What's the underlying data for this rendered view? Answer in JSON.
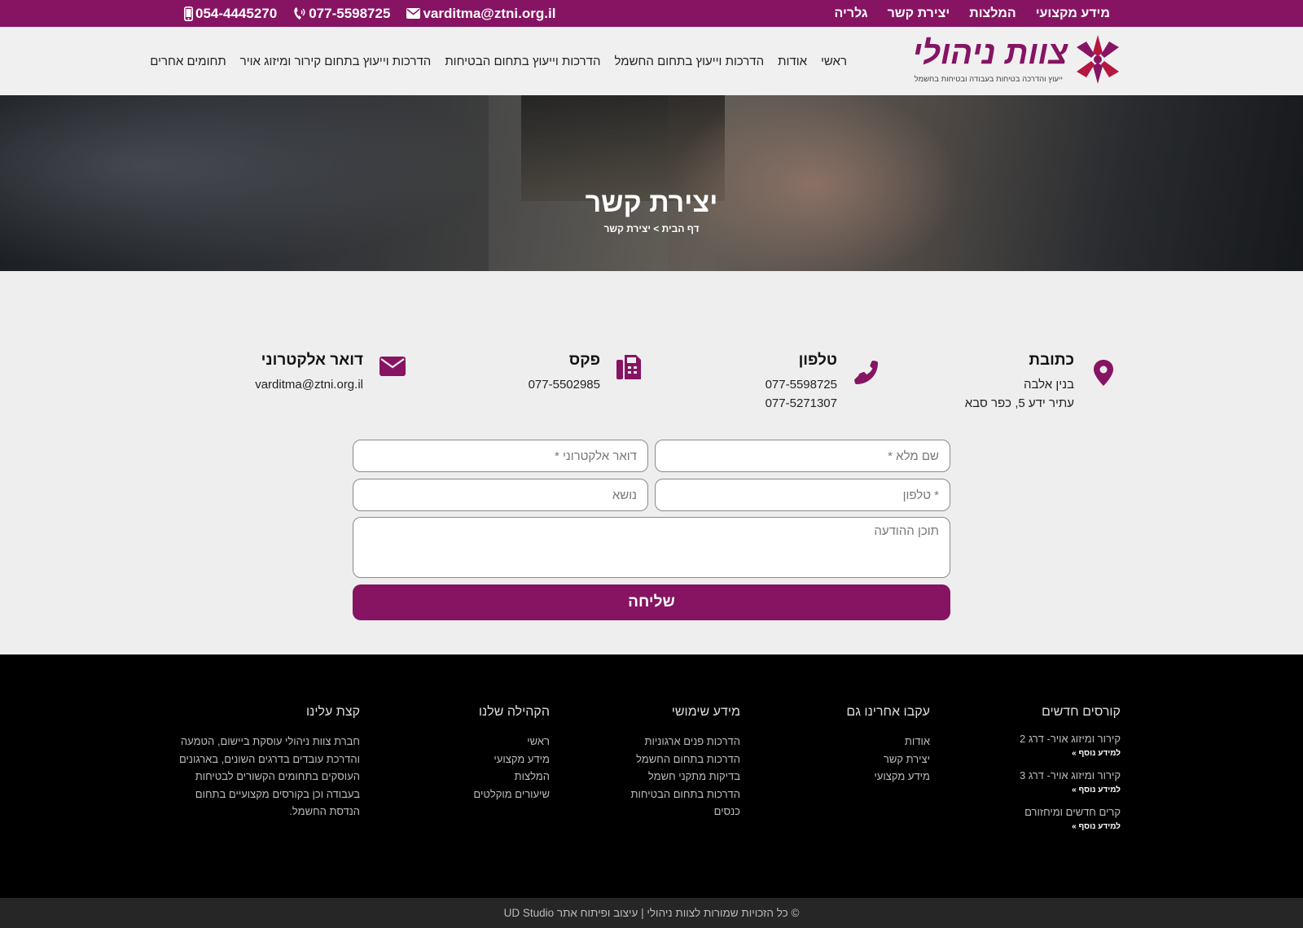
{
  "topbar": {
    "nav": [
      "מידע מקצועי",
      "המלצות",
      "יצירת קשר",
      "גלריה"
    ],
    "email": "varditma@ztni.org.il",
    "phone": "077-5598725",
    "mobile": "054-4445270"
  },
  "header": {
    "logo_title": "צוות ניהולי",
    "logo_tagline": "ייעוץ והדרכה בטיחות בעבודה ובטיחות בחשמל",
    "nav": [
      "ראשי",
      "אודות",
      "הדרכות וייעוץ בתחום החשמל",
      "הדרכות וייעוץ בתחום הבטיחות",
      "הדרכות וייעוץ בתחום קירור ומיזוג אויר",
      "תחומים אחרים"
    ]
  },
  "hero": {
    "title": "יצירת קשר",
    "breadcrumb": "דף הבית > יצירת קשר"
  },
  "info": {
    "address": {
      "title": "כתובת",
      "lines": [
        "בנין אלבה",
        "עתיר ידע 5, כפר סבא"
      ]
    },
    "phone": {
      "title": "טלפון",
      "lines": [
        "077-5598725",
        "077-5271307"
      ]
    },
    "fax": {
      "title": "פקס",
      "lines": [
        "077-5502985"
      ]
    },
    "email": {
      "title": "דואר אלקטרוני",
      "lines": [
        "varditma@ztni.org.il"
      ]
    }
  },
  "form": {
    "name_placeholder": "שם מלא *",
    "email_placeholder": "דואר אלקטרוני *",
    "phone_placeholder": "* טלפון",
    "subject_placeholder": "נושא",
    "message_placeholder": "תוכן ההודעה",
    "submit_label": "שליחה"
  },
  "footer": {
    "courses": {
      "title": "קורסים חדשים",
      "items": [
        {
          "name": "קירור ומיזוג אויר- דרג 2",
          "more": "למידע נוסף »"
        },
        {
          "name": "קירור ומיזוג אויר- דרג 3",
          "more": "למידע נוסף »"
        },
        {
          "name": "קרים חדשים ומיחזורם",
          "more": "למידע נוסף »"
        }
      ]
    },
    "follow": {
      "title": "עקבו אחרינו גם",
      "items": [
        "אודות",
        "יצירת קשר",
        "מידע מקצועי"
      ]
    },
    "useful": {
      "title": "מידע שימושי",
      "items": [
        "הדרכות פנים ארגוניות",
        "הדרכות בתחום החשמל",
        "בדיקות מתקני חשמל",
        "הדרכות בתחום הבטיחות",
        "כנסים"
      ]
    },
    "community": {
      "title": "הקהילה שלנו",
      "items": [
        "ראשי",
        "מידע מקצועי",
        "המלצות",
        "שיעורים מוקלטים"
      ]
    },
    "about": {
      "title": "קצת עלינו",
      "lines": [
        "חברת צוות ניהולי עוסקת ביישום, הטמעה",
        "והדרכת עובדים בדרגים השונים, בארגונים",
        "העוסקים בתחומים הקשורים לבטיחות",
        "בעבודה וכן בקורסים מקצועיים בתחום",
        "הנדסת החשמל."
      ]
    }
  },
  "copyright": "© כל הזכויות שמורות לצוות ניהולי | עיצוב ופיתוח אתר UD Studio",
  "colors": {
    "brand": "#861463",
    "footer_bg": "#000000",
    "copyright_bg": "#262626"
  }
}
